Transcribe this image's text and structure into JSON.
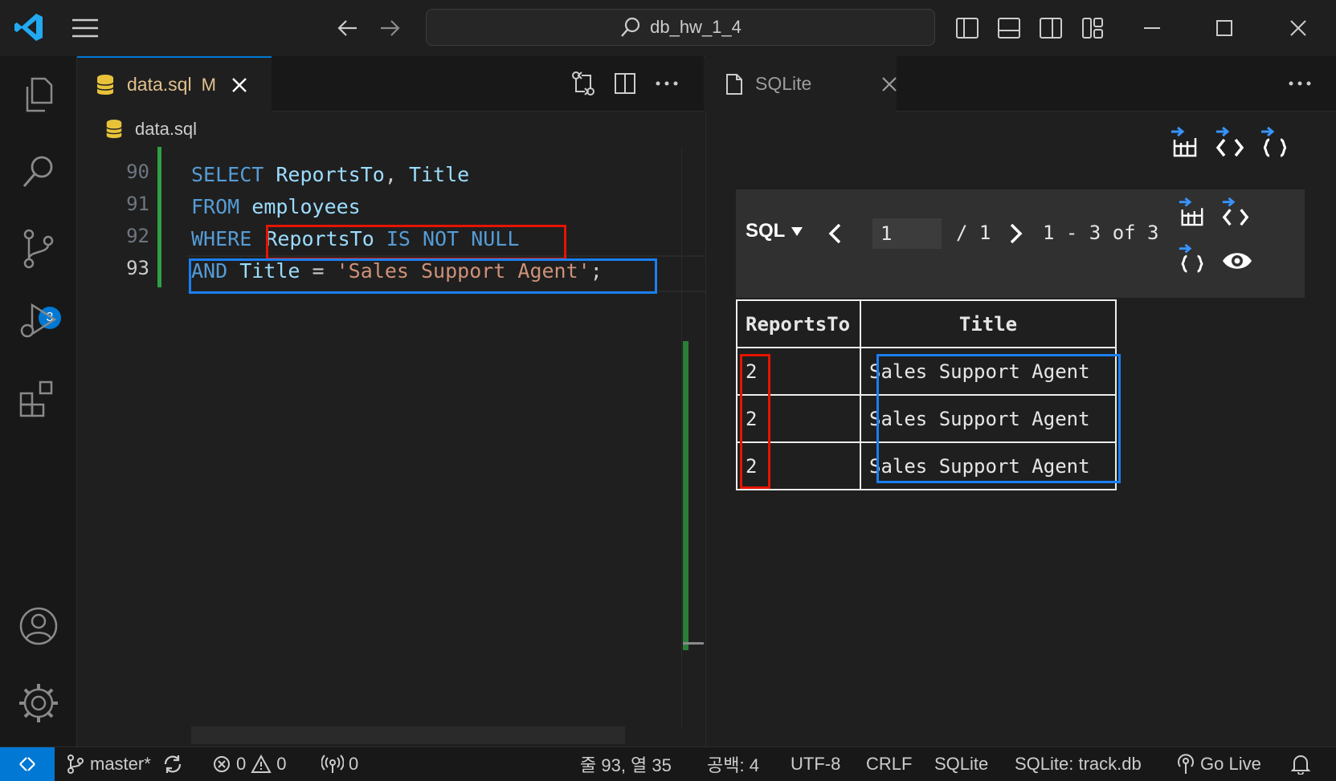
{
  "titlebar": {
    "search_text": "db_hw_1_4"
  },
  "activity": {
    "scm_badge": "3"
  },
  "editor": {
    "tab_label": "data.sql",
    "tab_modified": "M",
    "breadcrumb": "data.sql",
    "lines": [
      {
        "num": "90",
        "t1": "SELECT",
        "t2": " ReportsTo",
        "t3": ",",
        "t4": " Title"
      },
      {
        "num": "91",
        "t1": "FROM",
        "t2": " employees"
      },
      {
        "num": "92",
        "t1": "WHERE",
        "t2": "ReportsTo",
        "t3": " IS NOT NULL"
      },
      {
        "num": "93",
        "t1": "AND",
        "t2": " Title",
        "t3": " = ",
        "t4": "'Sales Support Agent'",
        "t5": ";"
      }
    ]
  },
  "panel": {
    "tab_label": "SQLite",
    "sql_label": "SQL",
    "page_current": "1",
    "page_total": "/ 1",
    "range_text": "1 - 3 of 3",
    "table": {
      "headers": [
        "ReportsTo",
        "Title"
      ],
      "rows": [
        [
          "2",
          "Sales Support Agent"
        ],
        [
          "2",
          "Sales Support Agent"
        ],
        [
          "2",
          "Sales Support Agent"
        ]
      ]
    }
  },
  "status": {
    "branch": "master*",
    "errors": "0",
    "warnings": "0",
    "ports": "0",
    "cursor": "줄 93, 열 35",
    "spaces": "공백: 4",
    "encoding": "UTF-8",
    "eol": "CRLF",
    "language": "SQLite",
    "db": "SQLite: track.db",
    "golive": "Go Live"
  },
  "colors": {
    "accent": "#0078d4",
    "highlight_red": "#e51400",
    "highlight_blue": "#1a7ff0",
    "git_added": "#2ea043"
  }
}
